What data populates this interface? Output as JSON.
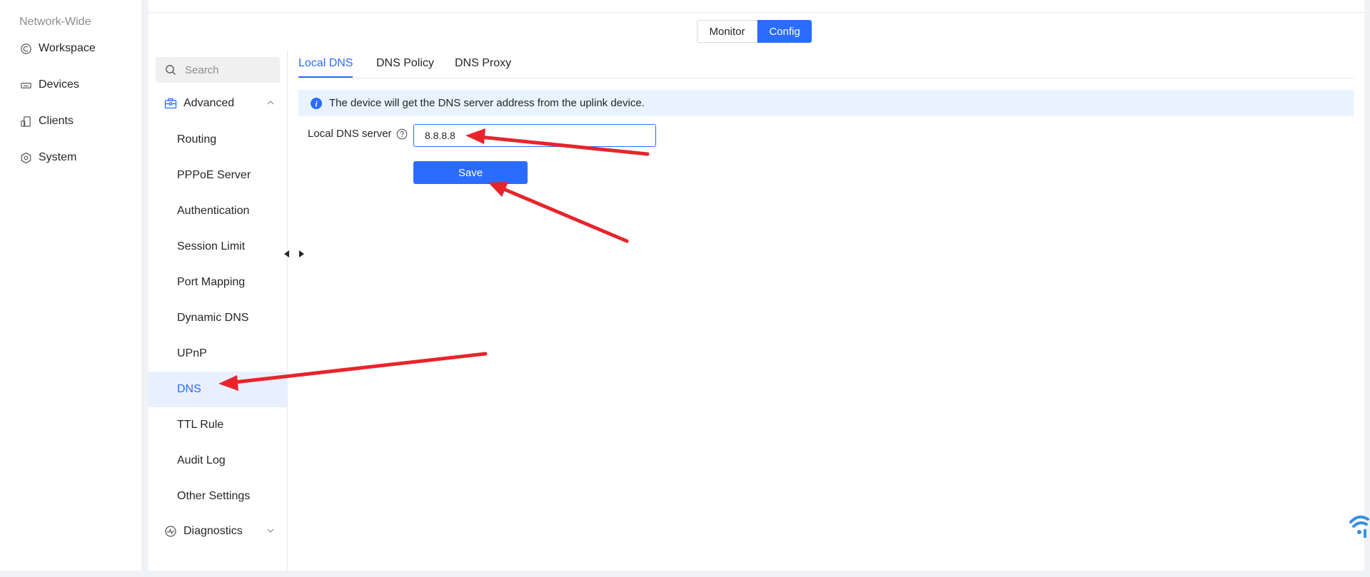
{
  "global_nav": {
    "section_label": "Network-Wide",
    "items": [
      {
        "label": "Workspace",
        "icon": "workspace-icon"
      },
      {
        "label": "Devices",
        "icon": "devices-icon"
      },
      {
        "label": "Clients",
        "icon": "clients-icon"
      },
      {
        "label": "System",
        "icon": "system-icon"
      }
    ]
  },
  "mode_toggle": {
    "monitor_label": "Monitor",
    "config_label": "Config",
    "selected": "Config"
  },
  "sidebar": {
    "search_placeholder": "Search",
    "advanced_label": "Advanced",
    "diagnostics_label": "Diagnostics",
    "items": [
      {
        "label": "Routing"
      },
      {
        "label": "PPPoE Server"
      },
      {
        "label": "Authentication"
      },
      {
        "label": "Session Limit"
      },
      {
        "label": "Port Mapping"
      },
      {
        "label": "Dynamic DNS"
      },
      {
        "label": "UPnP"
      },
      {
        "label": "DNS"
      },
      {
        "label": "TTL Rule"
      },
      {
        "label": "Audit Log"
      },
      {
        "label": "Other Settings"
      }
    ],
    "active_item": "DNS"
  },
  "tabs": [
    {
      "label": "Local DNS"
    },
    {
      "label": "DNS Policy"
    },
    {
      "label": "DNS Proxy"
    }
  ],
  "active_tab": "Local DNS",
  "info_banner": "The device will get the DNS server address from the uplink device.",
  "form": {
    "local_dns_label": "Local DNS server",
    "local_dns_value": "8.8.8.8",
    "save_label": "Save"
  },
  "colors": {
    "accent": "#2b6cff",
    "active_bg": "#e8f0ff",
    "banner_bg": "#e8f3ff",
    "annotation_arrow": "#e8242b"
  }
}
